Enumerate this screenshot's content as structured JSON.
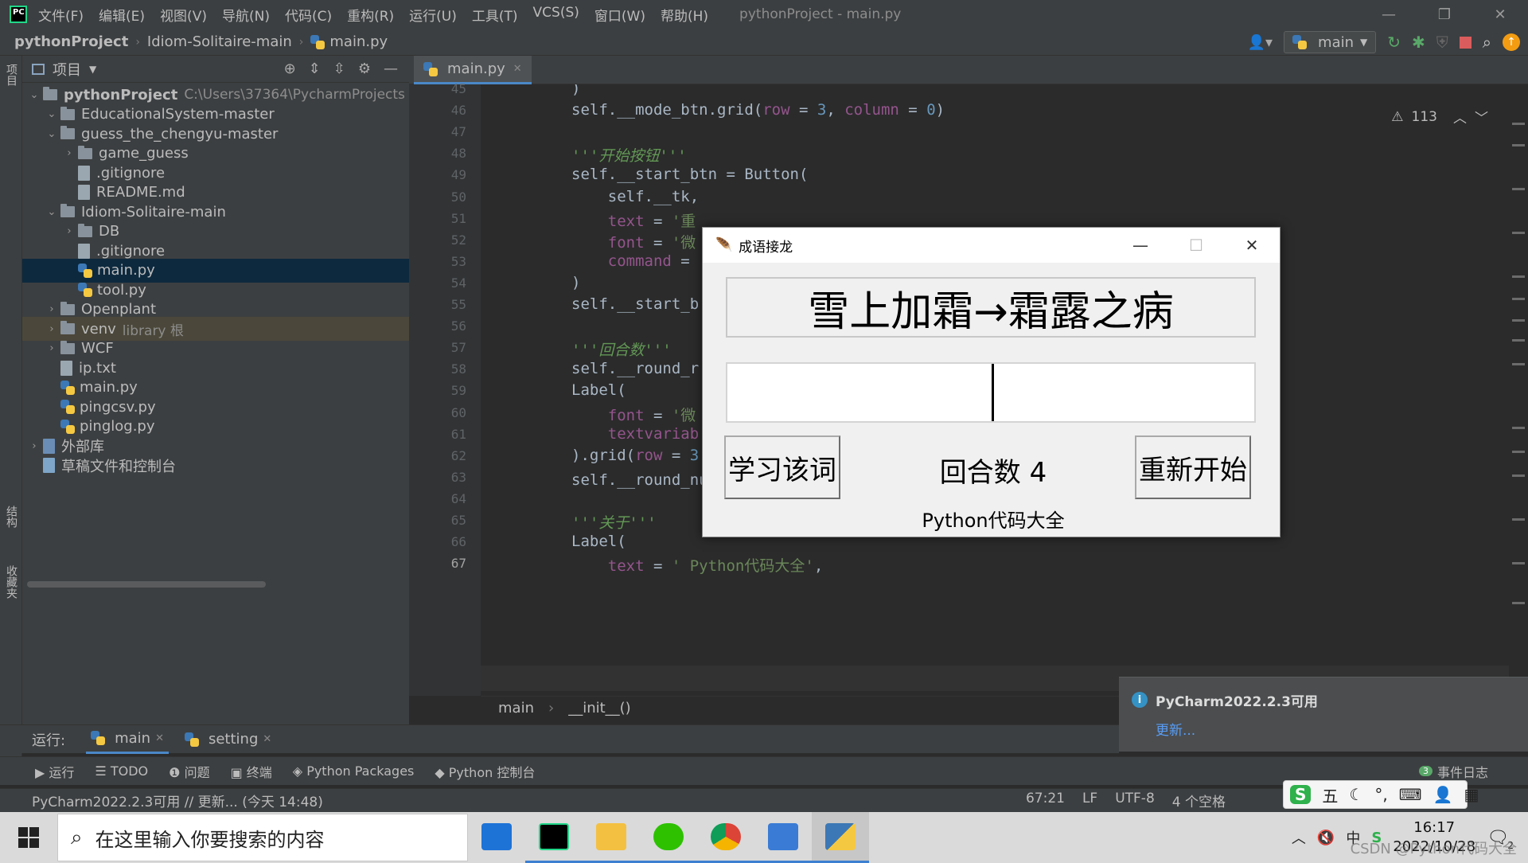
{
  "menubar": {
    "items": [
      "文件(F)",
      "编辑(E)",
      "视图(V)",
      "导航(N)",
      "代码(C)",
      "重构(R)",
      "运行(U)",
      "工具(T)",
      "VCS(S)",
      "窗口(W)",
      "帮助(H)"
    ],
    "window_title": "pythonProject - main.py"
  },
  "navbar": {
    "crumbs": [
      "pythonProject",
      "Idiom-Solitaire-main",
      "main.py"
    ],
    "run_config": "main"
  },
  "left_strip": {
    "project": "项目",
    "structure": "结构",
    "bookmarks": "收藏夹"
  },
  "project_panel": {
    "title": "项目",
    "tree": [
      {
        "label": "pythonProject",
        "hint": "C:\\Users\\37364\\PycharmProjects",
        "kind": "folder",
        "depth": 0,
        "arrow": "down",
        "bold": true
      },
      {
        "label": "EducationalSystem-master",
        "kind": "folder",
        "depth": 1,
        "arrow": "down"
      },
      {
        "label": "guess_the_chengyu-master",
        "kind": "folder",
        "depth": 1,
        "arrow": "down"
      },
      {
        "label": "game_guess",
        "kind": "folder",
        "depth": 2,
        "arrow": "right"
      },
      {
        "label": ".gitignore",
        "kind": "file",
        "depth": 2
      },
      {
        "label": "README.md",
        "kind": "file",
        "depth": 2
      },
      {
        "label": "Idiom-Solitaire-main",
        "kind": "folder",
        "depth": 1,
        "arrow": "down"
      },
      {
        "label": "DB",
        "kind": "folder",
        "depth": 2,
        "arrow": "right"
      },
      {
        "label": ".gitignore",
        "kind": "file",
        "depth": 2
      },
      {
        "label": "main.py",
        "kind": "py",
        "depth": 2,
        "selected": true
      },
      {
        "label": "tool.py",
        "kind": "py",
        "depth": 2
      },
      {
        "label": "Openplant",
        "kind": "folder",
        "depth": 1,
        "arrow": "right"
      },
      {
        "label": "venv",
        "hint": "library 根",
        "kind": "folder",
        "depth": 1,
        "arrow": "right",
        "lib": true
      },
      {
        "label": "WCF",
        "kind": "folder",
        "depth": 1,
        "arrow": "right"
      },
      {
        "label": "ip.txt",
        "kind": "file",
        "depth": 1
      },
      {
        "label": "main.py",
        "kind": "py",
        "depth": 1
      },
      {
        "label": "pingcsv.py",
        "kind": "py",
        "depth": 1
      },
      {
        "label": "pinglog.py",
        "kind": "py",
        "depth": 1
      },
      {
        "label": "外部库",
        "kind": "lib",
        "depth": 0,
        "arrow": "right"
      },
      {
        "label": "草稿文件和控制台",
        "kind": "scratch",
        "depth": 0
      }
    ]
  },
  "editor": {
    "tab": "main.py",
    "warnings": "113",
    "lines": [
      {
        "n": "45",
        "html": "<span>)</span>"
      },
      {
        "n": "46",
        "html": "self.__mode_btn.grid(<span class='p'>row</span> = <span class='n'>3</span>, <span class='p'>column</span> = <span class='n'>0</span>)"
      },
      {
        "n": "47",
        "html": ""
      },
      {
        "n": "48",
        "html": "<span class='d'>'''开始按钮'''</span>"
      },
      {
        "n": "49",
        "html": "self.__start_btn = Button("
      },
      {
        "n": "50",
        "html": "    self.__tk,"
      },
      {
        "n": "51",
        "html": "    <span class='p'>text</span> = <span class='s'>'重</span>"
      },
      {
        "n": "52",
        "html": "    <span class='p'>font</span> = <span class='s'>'微</span>"
      },
      {
        "n": "53",
        "html": "    <span class='p'>command</span> = "
      },
      {
        "n": "54",
        "html": ")"
      },
      {
        "n": "55",
        "html": "self.__start_b"
      },
      {
        "n": "56",
        "html": ""
      },
      {
        "n": "57",
        "html": "<span class='d'>'''回合数'''</span>"
      },
      {
        "n": "58",
        "html": "self.__round_r"
      },
      {
        "n": "59",
        "html": "Label("
      },
      {
        "n": "60",
        "html": "    <span class='p'>font</span> = <span class='s'>'微</span>"
      },
      {
        "n": "61",
        "html": "    <span class='p'>textvariab</span>"
      },
      {
        "n": "62",
        "html": ").grid(<span class='p'>row</span> = <span class='n'>3</span>, <span class='p'>column</span> = <span class='n'>1</span>, <span class='p'>padx</span> = <span class='n'>20</span>)"
      },
      {
        "n": "63",
        "html": "self.__round_num.set(<span class='s'>'回合数 0'</span>)"
      },
      {
        "n": "64",
        "html": ""
      },
      {
        "n": "65",
        "html": "<span class='d'>'''关于'''</span>"
      },
      {
        "n": "66",
        "html": "Label("
      },
      {
        "n": "67",
        "html": "    <span class='p'>text</span> = <span class='s'>' Python代码大全'</span>,"
      }
    ],
    "breadcrumb": [
      "main",
      "__init__()"
    ]
  },
  "tk_window": {
    "title": "成语接龙",
    "idiom": "雪上加霜→霜露之病",
    "learn_button": "学习该词",
    "round": "回合数 4",
    "restart_button": "重新开始",
    "about": "Python代码大全"
  },
  "notification": {
    "title": "PyCharm2022.2.3可用",
    "link": "更新..."
  },
  "run_bar": {
    "label": "运行:",
    "tabs": [
      "main",
      "setting"
    ]
  },
  "tool_windows": [
    "运行",
    "TODO",
    "问题",
    "终端",
    "Python Packages",
    "Python 控制台"
  ],
  "event_log": {
    "count": "3",
    "label": "事件日志"
  },
  "status": {
    "message": "PyCharm2022.2.3可用 // 更新... (今天 14:48)",
    "position": "67:21",
    "line_sep": "LF",
    "encoding": "UTF-8",
    "indent": "4 个空格"
  },
  "taskbar": {
    "search_placeholder": "在这里输入你要搜索的内容",
    "tray_lang": "中",
    "time": "16:17",
    "date": "2022/10/28",
    "notif_count": "2"
  },
  "ime": {
    "label": "五"
  },
  "watermark": "CSDN @Python代码大全"
}
